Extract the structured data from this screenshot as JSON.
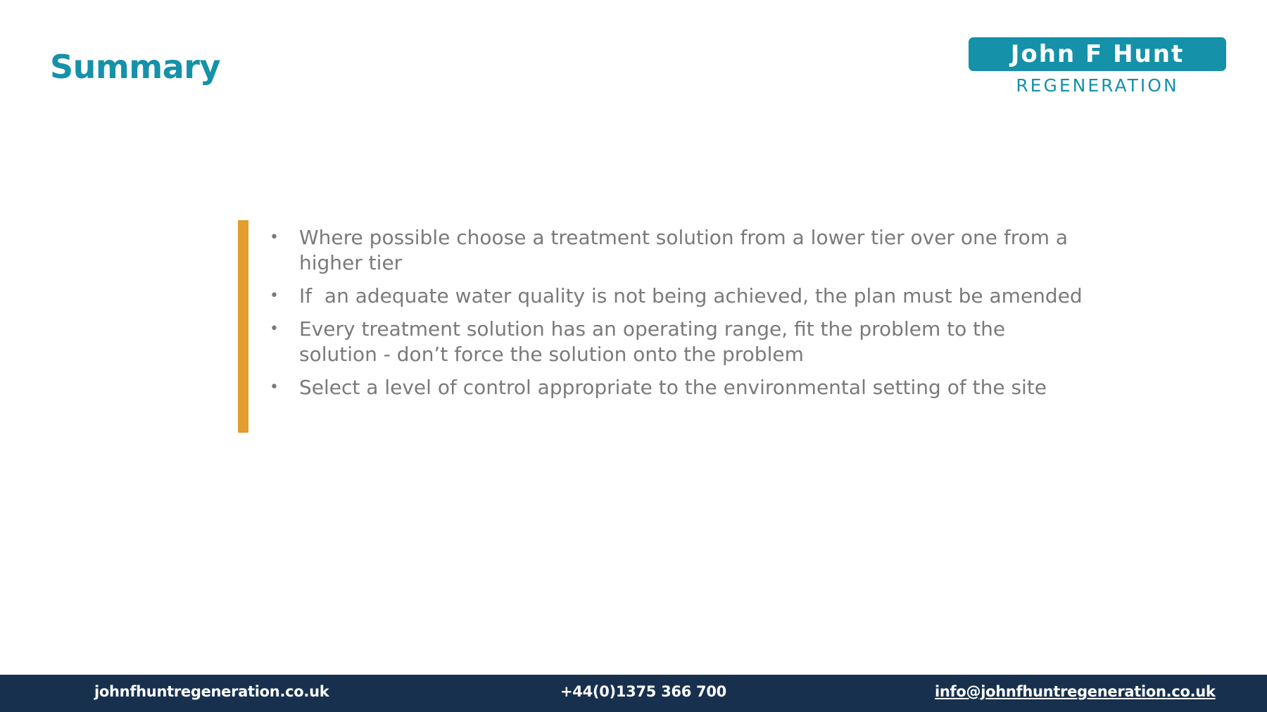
{
  "slide": {
    "title": "Summary",
    "logo": {
      "line1": "John F Hunt",
      "line2": "REGENERATION"
    },
    "bullets": [
      "Where possible choose a treatment solution from a lower tier over one from a higher tier",
      "If  an adequate water quality is not being achieved, the plan must be amended",
      "Every treatment solution has an operating range, fit the problem to the solution - don’t force the solution onto the problem",
      "Select a level of control appropriate to the environmental setting of the site"
    ],
    "bullet_symbol": "•"
  },
  "footer": {
    "website": "johnfhuntregeneration.co.uk",
    "phone": "+44(0)1375 366 700",
    "email": "info@johnfhuntregeneration.co.uk"
  },
  "colors": {
    "title": "#1591a9",
    "accent_bar": "#e19d2e",
    "body_text": "#7a7a7a",
    "footer_bg": "#17304e"
  }
}
